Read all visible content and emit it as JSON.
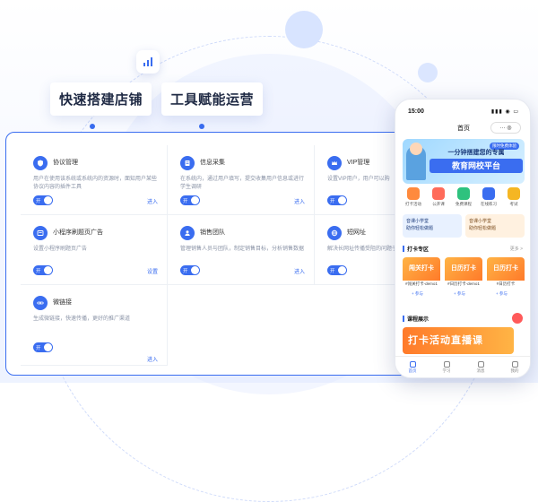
{
  "colors": {
    "accent": "#3a6df0",
    "orange": "#ff7a2a",
    "card_border": "#edf0f5"
  },
  "tags": {
    "quick_store": "快速搭建店铺",
    "tool_ops": "工具赋能运营"
  },
  "modules": [
    {
      "title": "协议管理",
      "desc": "用户在使用该系统或系统内的资源时，面知用户某些协议内容的插件工具",
      "toggle": "开",
      "link": "进入",
      "icon": "shield-icon"
    },
    {
      "title": "信息采集",
      "desc": "在系统内，通过用户填写，提交收集用户信息或进行学生调研",
      "toggle": "开",
      "link": "进入",
      "icon": "form-icon"
    },
    {
      "title": "VIP管理",
      "desc": "设置VIP用户，用户可以购",
      "toggle": "开",
      "link": "进入",
      "icon": "crown-icon"
    },
    {
      "title": "小程序刷题页广告",
      "desc": "设置小程序刷题页广告",
      "toggle": "开",
      "link": "设置",
      "icon": "ad-icon"
    },
    {
      "title": "销售团队",
      "desc": "管理销售人员与团队，制定销售目标，分析销售数据",
      "toggle": "开",
      "link": "进入",
      "icon": "team-icon"
    },
    {
      "title": "短网址",
      "desc": "解决长网址传播受阻的问题子传播",
      "toggle": "开",
      "link": "进入",
      "icon": "globe-icon"
    },
    {
      "title": "微链接",
      "desc": "生成微链接，快速传播，更好的推广渠道",
      "toggle": "开",
      "link": "进入",
      "icon": "link-icon"
    }
  ],
  "phone": {
    "time": "15:00",
    "signal": "▮▮▮ ◉ ▭",
    "title": "首页",
    "capsule": "··· ◎",
    "banner": {
      "line1": "一分钟搭建您的专属",
      "line2": "教育网校平台",
      "pill": "限时免费体验"
    },
    "shortcuts": [
      {
        "label": "打卡活动",
        "color": "#ff8a3d"
      },
      {
        "label": "公开课",
        "color": "#ff6b5a"
      },
      {
        "label": "免费课程",
        "color": "#2ec27e"
      },
      {
        "label": "在线练习",
        "color": "#3a6df0"
      },
      {
        "label": "考试",
        "color": "#f5b623"
      }
    ],
    "promos": [
      {
        "line1": "音课小学堂",
        "line2": "助你轻松做题"
      },
      {
        "line1": "音课小学堂",
        "line2": "助你轻松做题"
      }
    ],
    "punch_header": "打卡专区",
    "more": "更多 >",
    "punch_cards": [
      {
        "title": "闯关打卡",
        "caption": "#闯关打卡-demo1"
      },
      {
        "title": "日历打卡",
        "caption": "#日历打卡-demo1"
      },
      {
        "title": "日历打卡",
        "caption": "#日历打卡"
      }
    ],
    "join": "+ 参与",
    "course_header": "课程展示",
    "course_banner": "打卡活动直播课",
    "tabs": [
      "首页",
      "学习",
      "消息",
      "我的"
    ]
  }
}
